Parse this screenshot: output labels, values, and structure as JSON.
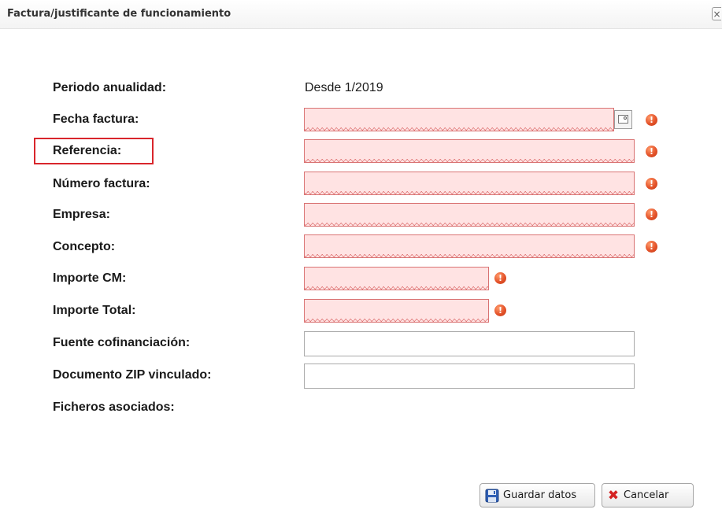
{
  "dialog": {
    "title": "Factura/justificante de funcionamiento",
    "close_glyph": "×"
  },
  "form": {
    "fields": [
      {
        "label": "Periodo anualidad:",
        "value": "Desde 1/2019"
      },
      {
        "label": "Fecha factura:",
        "value": "",
        "state": "invalid",
        "icon": "calendar-icon"
      },
      {
        "label": "Referencia:",
        "value": "",
        "state": "invalid",
        "highlighted": true
      },
      {
        "label": "Número factura:",
        "value": "",
        "state": "invalid"
      },
      {
        "label": "Empresa:",
        "value": "",
        "state": "invalid"
      },
      {
        "label": "Concepto:",
        "value": "",
        "state": "invalid"
      },
      {
        "label": "Importe CM:",
        "value": "",
        "state": "invalid"
      },
      {
        "label": "Importe Total:",
        "value": "",
        "state": "invalid"
      },
      {
        "label": "Fuente cofinanciación:",
        "value": "",
        "state": "normal"
      },
      {
        "label": "Documento ZIP vinculado:",
        "value": "",
        "state": "normal"
      },
      {
        "label": "Ficheros asociados:"
      }
    ],
    "warning_glyph": "!"
  },
  "buttons": {
    "save_label": "Guardar datos",
    "cancel_label": "Cancelar",
    "save_icon": "floppy-disk-icon",
    "cancel_icon": "red-x-icon"
  },
  "colors": {
    "invalid_bg": "#ffe3e3",
    "invalid_border": "#d97373",
    "warning": "#e4532a",
    "highlight_box": "#d9262c"
  }
}
